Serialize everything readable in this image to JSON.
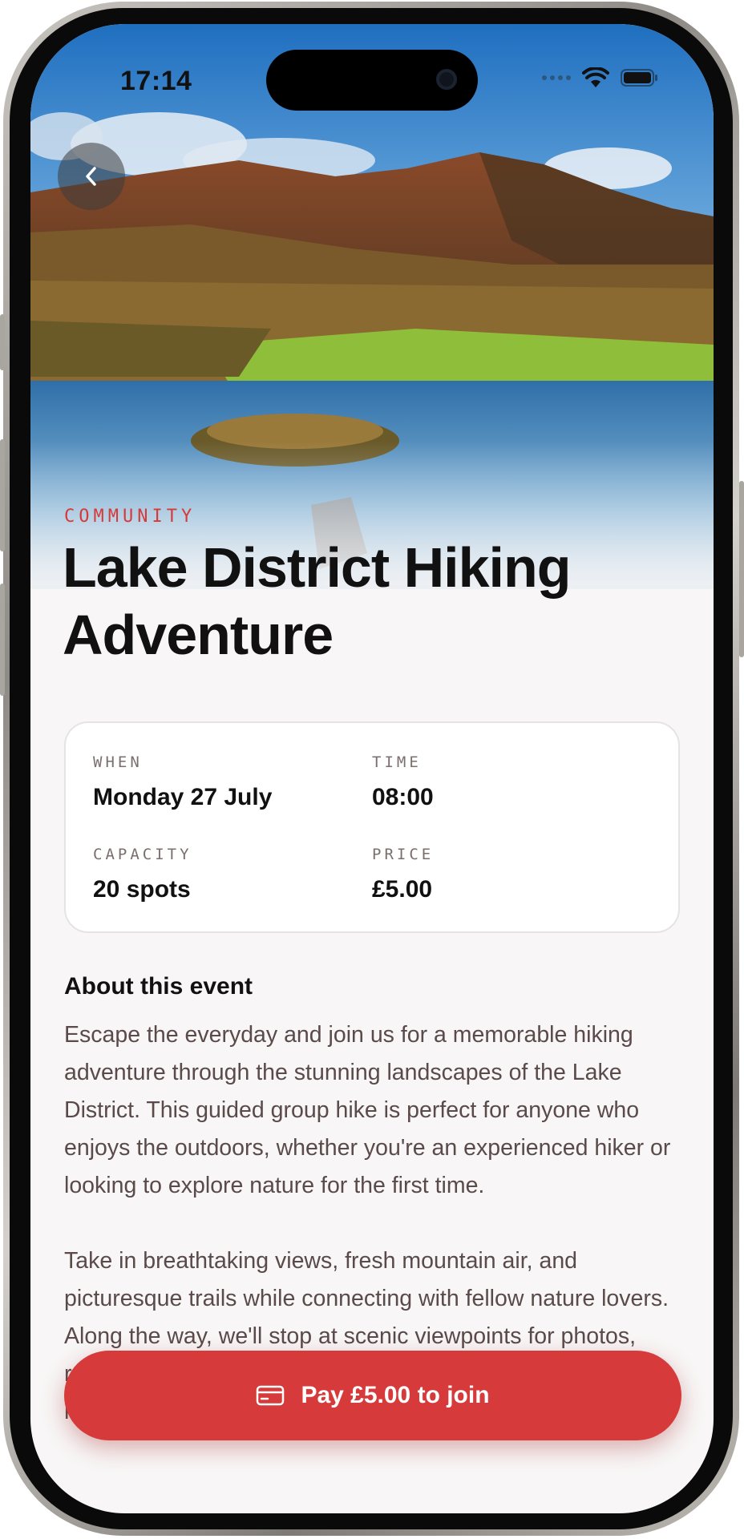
{
  "status_bar": {
    "time": "17:14"
  },
  "navigation": {
    "back_icon": "chevron-left-icon"
  },
  "event": {
    "category": "COMMUNITY",
    "title": "Lake District Hiking Adventure",
    "details": {
      "when_label": "WHEN",
      "when_value": "Monday 27 July",
      "time_label": "TIME",
      "time_value": "08:00",
      "capacity_label": "CAPACITY",
      "capacity_value": "20 spots",
      "price_label": "PRICE",
      "price_value": "£5.00"
    },
    "about_heading": "About this event",
    "about_paragraphs": [
      "Escape the everyday and join us for a memorable hiking adventure through the stunning landscapes of the Lake District. This guided group hike is perfect for anyone who enjoys the outdoors, whether you're an experienced hiker or looking to explore nature for the first time.",
      "Take in breathtaking views, fresh mountain air, and picturesque trails while connecting with fellow nature lovers. Along the way, we'll stop at scenic viewpoints for photos, refreshments, and a chance to appreciate one of the UK's most beautiful national"
    ]
  },
  "cta": {
    "label": "Pay £5.00 to join",
    "icon": "credit-card-icon",
    "color": "#d63a3a"
  },
  "colors": {
    "accent": "#d63a38",
    "background": "#f8f6f6"
  }
}
